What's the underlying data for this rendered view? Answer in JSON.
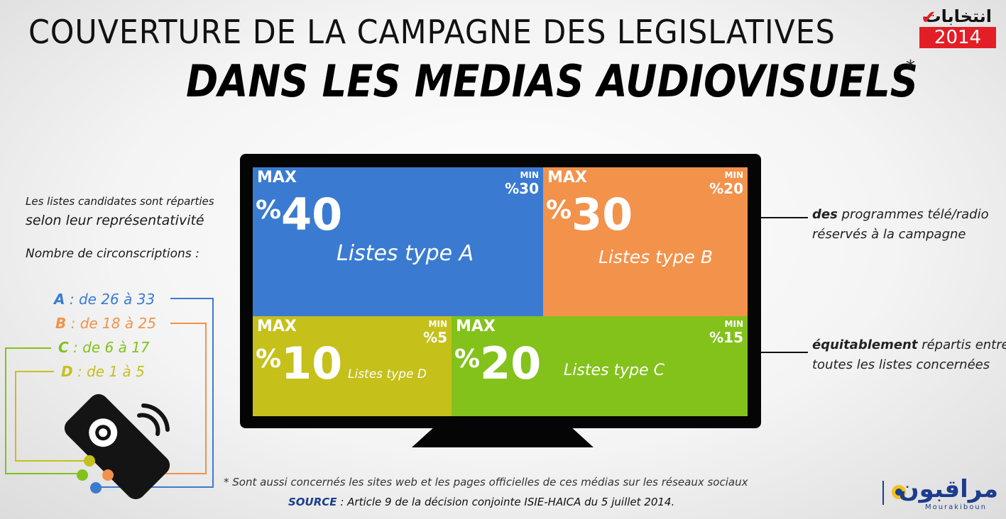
{
  "header": {
    "title_line1": "COUVERTURE DE LA CAMPAGNE DES LEGISLATIVES",
    "title_line2": "DANS LES MEDIAS AUDIOVISUELS",
    "title_star": "*",
    "logo_top": "انتخابات",
    "logo_year": "2014"
  },
  "left_panel": {
    "intro_line1": "Les listes candidates sont réparties",
    "intro_line2": "selon leur représentativité",
    "circ_label": "Nombre de circonscriptions :",
    "categories": [
      {
        "letter": "A",
        "text": " : de 26 à 33",
        "color": "#3a7bd1"
      },
      {
        "letter": "B",
        "text": " : de 18 à 25",
        "color": "#f2924b"
      },
      {
        "letter": "C",
        "text": " : de 6 à 17",
        "color": "#82c21a"
      },
      {
        "letter": "D",
        "text": " : de 1 à 5",
        "color": "#c5c01a"
      }
    ]
  },
  "tv": {
    "blocks": [
      {
        "id": "a",
        "max_label": "MAX",
        "max_value": "40",
        "pct": "%",
        "min_label": "MIN",
        "min_value": "%30",
        "list_label": "Listes type A",
        "color": "#3a7bd1"
      },
      {
        "id": "b",
        "max_label": "MAX",
        "max_value": "30",
        "pct": "%",
        "min_label": "MIN",
        "min_value": "%20",
        "list_label": "Listes type B",
        "color": "#f2924b"
      },
      {
        "id": "d",
        "max_label": "MAX",
        "max_value": "10",
        "pct": "%",
        "min_label": "MIN",
        "min_value": "%5",
        "list_label": "Listes type D",
        "color": "#c5c01a"
      },
      {
        "id": "c",
        "max_label": "MAX",
        "max_value": "20",
        "pct": "%",
        "min_label": "MIN",
        "min_value": "%15",
        "list_label": "Listes type C",
        "color": "#82c21a"
      }
    ]
  },
  "notes": {
    "note1_bold": "des",
    "note1_rest": " programmes télé/radio",
    "note1_line2": "réservés à la campagne",
    "note2_bold": "équitablement",
    "note2_rest": " répartis entre",
    "note2_line2": "toutes les listes concernées"
  },
  "footer": {
    "footnote": "*  Sont aussi concernés les sites web et les pages officielles de ces médias sur les réseaux sociaux",
    "source_label": "SOURCE",
    "source_text": " : Article 9 de la décision conjointe ISIE-HAICA du 5 juillet 2014.",
    "logo_arabic": "مراقبون",
    "logo_latin": "Mourakiboun"
  }
}
